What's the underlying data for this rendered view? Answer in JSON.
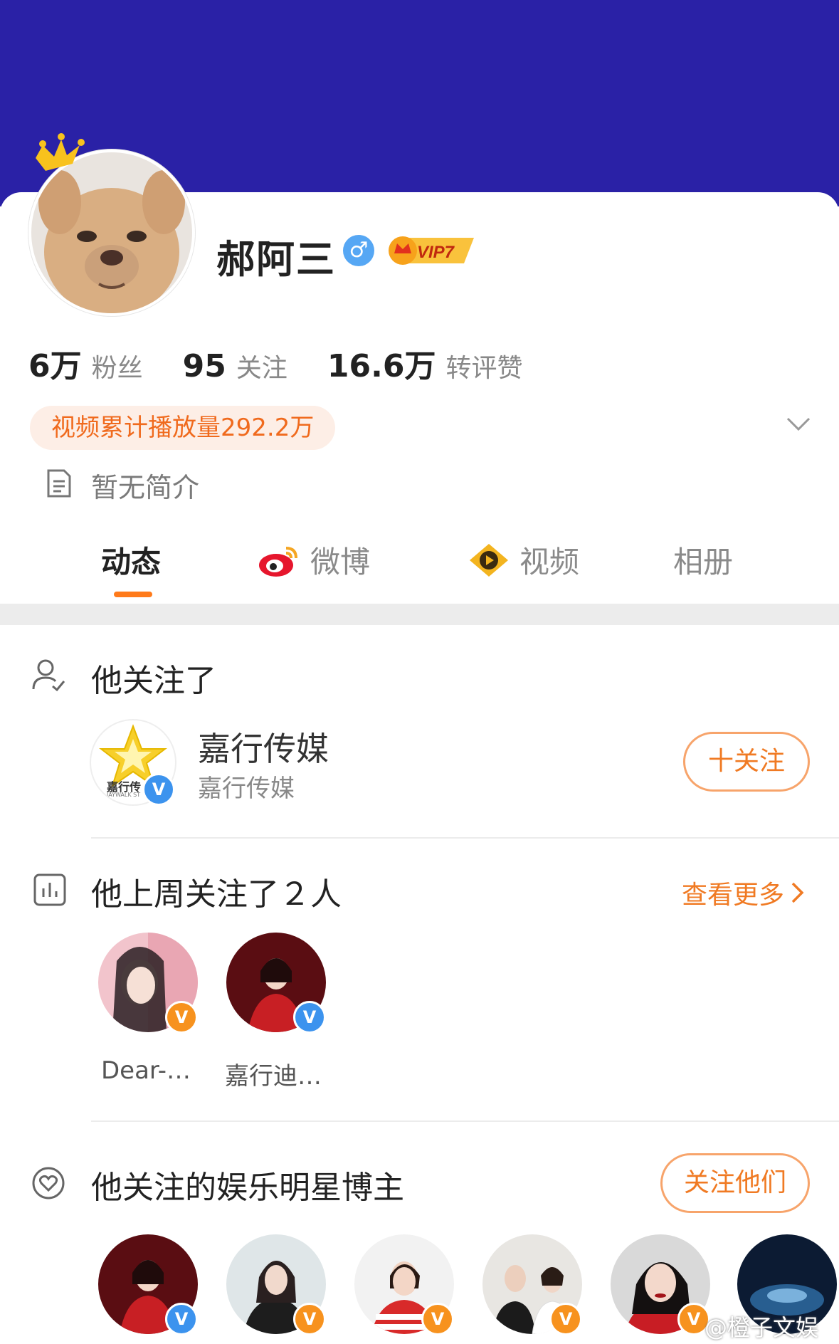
{
  "profile": {
    "name": "郝阿三",
    "gender_symbol": "♂",
    "vip_label": "VIP7",
    "stats": [
      {
        "value": "6万",
        "label": "粉丝"
      },
      {
        "value": "95",
        "label": "关注"
      },
      {
        "value": "16.6万",
        "label": "转评赞"
      }
    ],
    "video_plays": "视频累计播放量292.2万",
    "intro": "暂无简介"
  },
  "tabs": [
    {
      "label": "动态",
      "icon": "none"
    },
    {
      "label": "微博",
      "icon": "weibo-icon"
    },
    {
      "label": "视频",
      "icon": "video-play-icon"
    },
    {
      "label": "相册",
      "icon": "none"
    }
  ],
  "followed_section": {
    "title": "他关注了",
    "account_name": "嘉行传媒",
    "account_sub": "嘉行传媒",
    "logo_text": "嘉行传",
    "logo_subtext": "JAYWALK ST",
    "follow_label": "十关注"
  },
  "last_week_section": {
    "title": "他上周关注了２人",
    "more_label": "查看更多",
    "people": [
      {
        "name": "Dear-…",
        "badge": "V",
        "badge_color": "#f7921e"
      },
      {
        "name": "嘉行迪…",
        "badge": "V",
        "badge_color": "#3c93ee"
      }
    ]
  },
  "stars_section": {
    "title": "他关注的娱乐明星博主",
    "button_label": "关注他们",
    "avatars": [
      {
        "badge": "V",
        "badge_color": "#3c93ee"
      },
      {
        "badge": "V",
        "badge_color": "#f7921e"
      },
      {
        "badge": "V",
        "badge_color": "#f7921e"
      },
      {
        "badge": "V",
        "badge_color": "#f7921e"
      },
      {
        "badge": "V",
        "badge_color": "#f7921e"
      }
    ]
  },
  "watermark": "@橙子文娱",
  "colors": {
    "banner": "#2a21a6",
    "accent": "#f06a1d",
    "tab_underline": "#ff7a1a"
  }
}
